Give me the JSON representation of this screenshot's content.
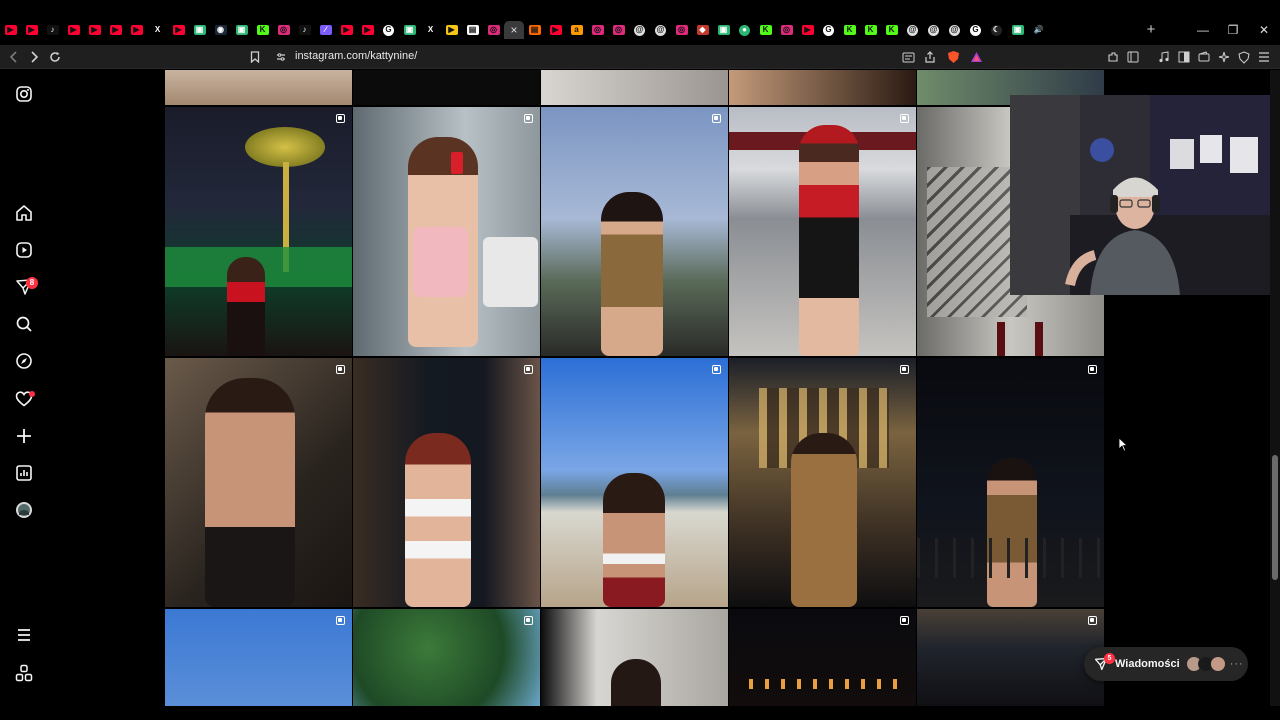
{
  "browser": {
    "url": "instagram.com/kattynine/",
    "tabs": [
      {
        "icon": "youtube-icon",
        "color": "#ff0033",
        "glyph": "▶"
      },
      {
        "icon": "youtube-icon",
        "color": "#ff0033",
        "glyph": "▶"
      },
      {
        "icon": "tiktok-icon",
        "color": "#111111",
        "glyph": "♪"
      },
      {
        "icon": "youtube-icon",
        "color": "#ff0033",
        "glyph": "▶"
      },
      {
        "icon": "youtube-icon",
        "color": "#ff0033",
        "glyph": "▶"
      },
      {
        "icon": "youtube-icon",
        "color": "#ff0033",
        "glyph": "▶"
      },
      {
        "icon": "youtube-icon",
        "color": "#ff0033",
        "glyph": "▶"
      },
      {
        "icon": "x-icon",
        "color": "#000000",
        "glyph": "X"
      },
      {
        "icon": "youtube-icon",
        "color": "#ff0033",
        "glyph": "▶"
      },
      {
        "icon": "chat-icon",
        "color": "#2bb673",
        "glyph": "▣"
      },
      {
        "icon": "steam-icon",
        "color": "#1b2838",
        "glyph": "◉"
      },
      {
        "icon": "chat-icon",
        "color": "#2bb673",
        "glyph": "▣"
      },
      {
        "icon": "kick-icon",
        "color": "#53fc18",
        "glyph": "K"
      },
      {
        "icon": "instagram-icon",
        "color": "#dd2a7b",
        "glyph": "◎"
      },
      {
        "icon": "tiktok-icon",
        "color": "#111111",
        "glyph": "♪"
      },
      {
        "icon": "feather-icon",
        "color": "#7d5cff",
        "glyph": "∕"
      },
      {
        "icon": "youtube-icon",
        "color": "#ff0033",
        "glyph": "▶"
      },
      {
        "icon": "youtube-icon",
        "color": "#ff0033",
        "glyph": "▶"
      },
      {
        "icon": "google-icon",
        "color": "#ffffff",
        "glyph": "G"
      },
      {
        "icon": "chat-icon",
        "color": "#2bb673",
        "glyph": "▣"
      },
      {
        "icon": "x-icon",
        "color": "#000000",
        "glyph": "X"
      },
      {
        "icon": "play-icon",
        "color": "#f5c518",
        "glyph": "▶"
      },
      {
        "icon": "document-icon",
        "color": "#ffffff",
        "glyph": "▤"
      },
      {
        "icon": "instagram-icon",
        "color": "#dd2a7b",
        "glyph": "◎"
      },
      {
        "icon": "close-tab-icon",
        "color": "#3a3a3c",
        "glyph": "×",
        "active": true
      },
      {
        "icon": "pdf-icon",
        "color": "#ff6a00",
        "glyph": "▤"
      },
      {
        "icon": "youtube-icon",
        "color": "#ff0033",
        "glyph": "▶"
      },
      {
        "icon": "amazon-icon",
        "color": "#ff9900",
        "glyph": "a"
      },
      {
        "icon": "instagram-icon",
        "color": "#dd2a7b",
        "glyph": "◎"
      },
      {
        "icon": "instagram-icon",
        "color": "#dd2a7b",
        "glyph": "◎"
      },
      {
        "icon": "threads-icon",
        "color": "#dddddd",
        "glyph": "@"
      },
      {
        "icon": "threads-icon",
        "color": "#dddddd",
        "glyph": "@"
      },
      {
        "icon": "instagram-icon",
        "color": "#dd2a7b",
        "glyph": "◎"
      },
      {
        "icon": "extension-icon",
        "color": "#c0392b",
        "glyph": "◆"
      },
      {
        "icon": "chat-icon",
        "color": "#2bb673",
        "glyph": "▣"
      },
      {
        "icon": "dot-icon",
        "color": "#2bb673",
        "glyph": "●"
      },
      {
        "icon": "kick-icon",
        "color": "#53fc18",
        "glyph": "K"
      },
      {
        "icon": "instagram-icon",
        "color": "#dd2a7b",
        "glyph": "◎"
      },
      {
        "icon": "youtube-icon",
        "color": "#ff0033",
        "glyph": "▶"
      },
      {
        "icon": "google-icon",
        "color": "#ffffff",
        "glyph": "G"
      },
      {
        "icon": "kick-icon",
        "color": "#53fc18",
        "glyph": "K"
      },
      {
        "icon": "kick-icon",
        "color": "#53fc18",
        "glyph": "K"
      },
      {
        "icon": "kick-icon",
        "color": "#53fc18",
        "glyph": "K"
      },
      {
        "icon": "threads-icon",
        "color": "#dddddd",
        "glyph": "@"
      },
      {
        "icon": "threads-icon",
        "color": "#dddddd",
        "glyph": "@"
      },
      {
        "icon": "threads-icon",
        "color": "#dddddd",
        "glyph": "@"
      },
      {
        "icon": "google-icon",
        "color": "#ffffff",
        "glyph": "G"
      },
      {
        "icon": "moon-icon",
        "color": "#222222",
        "glyph": "☾"
      },
      {
        "icon": "chat-icon",
        "color": "#2bb673",
        "glyph": "▣"
      },
      {
        "icon": "audio-icon",
        "color": "#000000",
        "glyph": "🔊"
      }
    ],
    "new_tab_glyph": "+",
    "window_controls": {
      "minimize": "—",
      "restore": "❐",
      "close": "✕"
    }
  },
  "instagram": {
    "nav": [
      {
        "name": "instagram-logo-icon",
        "badge": ""
      },
      {
        "name": "home-icon",
        "badge": ""
      },
      {
        "name": "reels-icon",
        "badge": ""
      },
      {
        "name": "messages-icon",
        "badge": "8"
      },
      {
        "name": "search-icon",
        "badge": ""
      },
      {
        "name": "explore-icon",
        "badge": ""
      },
      {
        "name": "notifications-icon",
        "badge": "dot"
      },
      {
        "name": "create-icon",
        "badge": ""
      },
      {
        "name": "dashboard-icon",
        "badge": ""
      },
      {
        "name": "profile-avatar-icon",
        "badge": ""
      },
      {
        "name": "more-menu-icon",
        "badge": ""
      },
      {
        "name": "also-from-meta-icon",
        "badge": ""
      }
    ],
    "posts_multi_icon": "carousel-icon",
    "messages_pill": {
      "label": "Wiadomości",
      "badge": "5"
    }
  }
}
